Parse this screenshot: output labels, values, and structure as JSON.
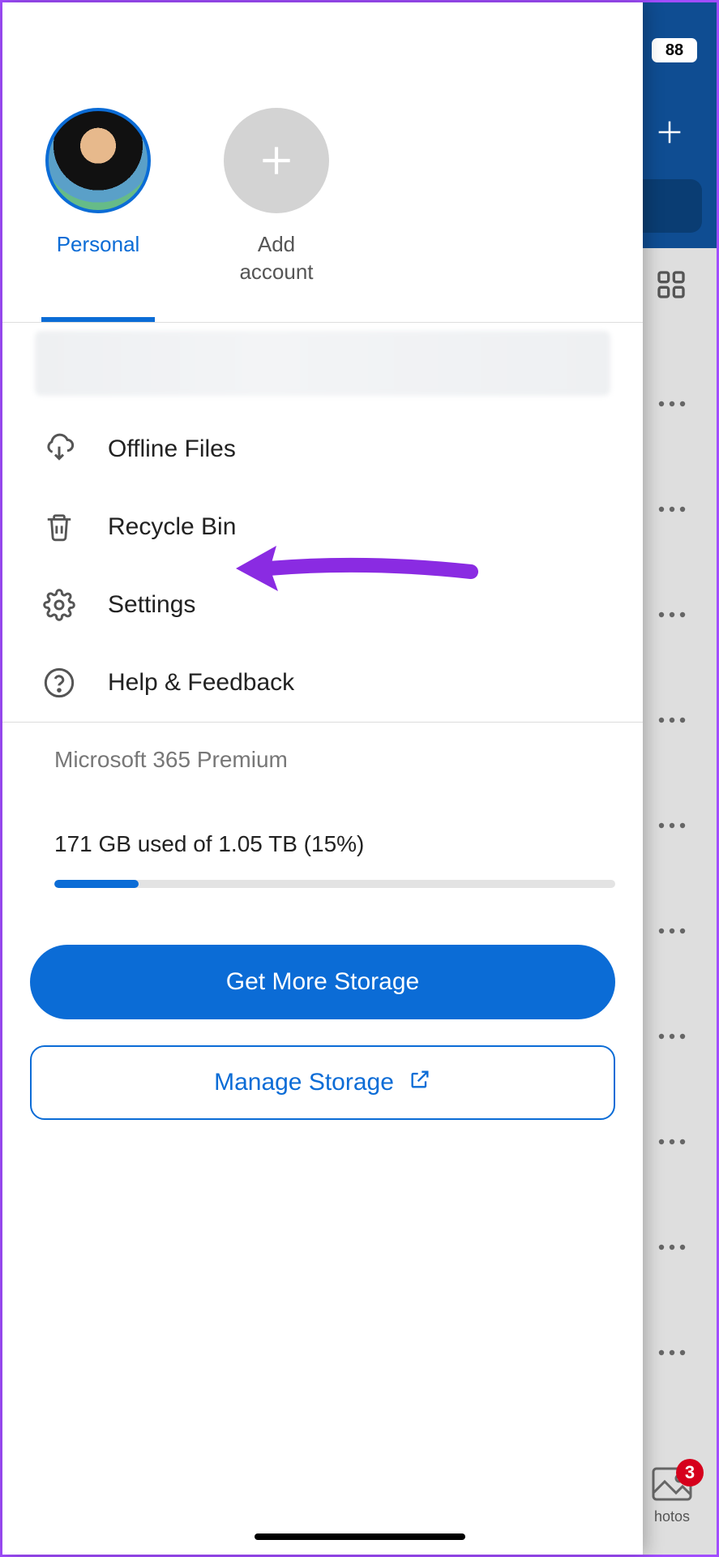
{
  "status_bar": {
    "battery": "88"
  },
  "background": {
    "plus_icon": "plus",
    "grid_icon": "grid",
    "row_actions": [
      "more",
      "more",
      "more",
      "more",
      "more",
      "more",
      "more",
      "more",
      "more",
      "more"
    ],
    "bottom_tab": {
      "label": "hotos",
      "badge": "3"
    }
  },
  "drawer": {
    "accounts": {
      "personal_label": "Personal",
      "add_label_line1": "Add",
      "add_label_line2": "account"
    },
    "menu": {
      "offline_files": "Offline Files",
      "recycle_bin": "Recycle Bin",
      "settings": "Settings",
      "help_feedback": "Help & Feedback"
    },
    "storage": {
      "plan": "Microsoft 365 Premium",
      "used_text": "171 GB used of 1.05 TB (15%)",
      "percent": 15,
      "get_more": "Get More Storage",
      "manage": "Manage Storage"
    }
  }
}
